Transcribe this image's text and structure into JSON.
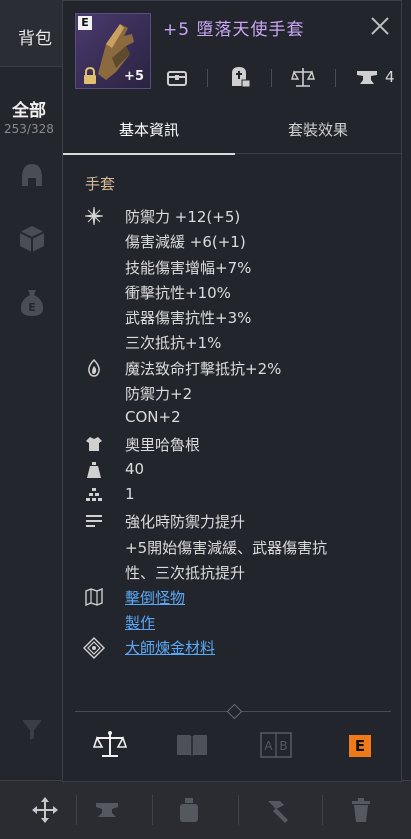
{
  "background": {
    "tab_label": "背包",
    "all_label": "全部",
    "count": "253/328"
  },
  "item": {
    "grade": "E",
    "enhance": "+5",
    "title": "+5 墮落天使手套",
    "durability_count": "4"
  },
  "tabs": [
    {
      "label": "基本資訊",
      "active": true
    },
    {
      "label": "套裝效果",
      "active": false
    }
  ],
  "category": "手套",
  "stats": {
    "main": [
      "防禦力 +12(+5)",
      "傷害減緩 +6(+1)",
      "技能傷害增幅+7%",
      "衝擊抗性+10%",
      "武器傷害抗性+3%",
      "三次抵抗+1%"
    ],
    "extra": [
      "魔法致命打擊抵抗+2%",
      "防禦力+2",
      "CON+2"
    ],
    "race": "奧里哈魯根",
    "weight": "40",
    "level": "1",
    "note": [
      "強化時防禦力提升",
      "+5開始傷害減緩、武器傷害抗",
      "性、三次抵抗提升"
    ],
    "source": [
      "擊倒怪物",
      "製作"
    ],
    "material": "大師煉金材料"
  },
  "footer": {
    "grade_badge": "E"
  },
  "colors": {
    "title": "#c9a7f5",
    "link": "#5aa8f5",
    "category": "#d6b89a",
    "grade_badge": "#f07a1a"
  }
}
